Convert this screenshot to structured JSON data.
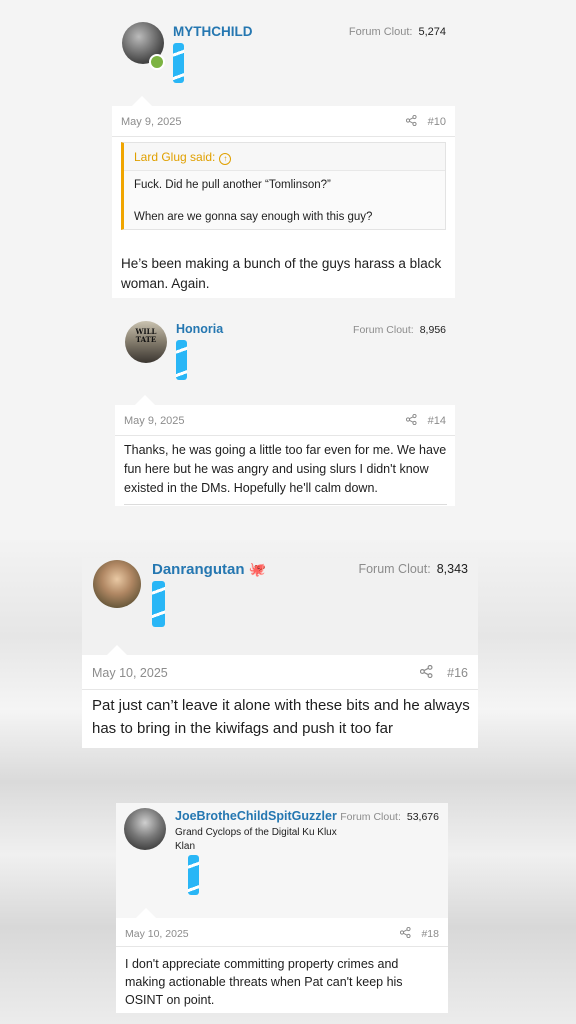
{
  "posts": [
    {
      "username": "MYTHCHILD",
      "forum_clout_label": "Forum Clout:",
      "forum_clout_value": "5,274",
      "date": "May 9, 2025",
      "post_number": "#10",
      "quote": {
        "author": "Lard Glug said:",
        "lines": [
          "Fuck. Did he pull another “Tomlinson?”",
          "When are we gonna say enough with this guy?"
        ]
      },
      "message": "He’s been making a bunch of the guys harass a black woman. Again."
    },
    {
      "username": "Honoria",
      "avatar_text": "WILL TATE",
      "forum_clout_label": "Forum Clout:",
      "forum_clout_value": "8,956",
      "date": "May 9, 2025",
      "post_number": "#14",
      "message": "Thanks, he was going a little too far even for me. We have fun here but he was angry and using slurs I didn't know existed in the DMs. Hopefully he'll calm down."
    },
    {
      "username": "Danrangutan",
      "forum_clout_label": "Forum Clout:",
      "forum_clout_value": "8,343",
      "date": "May 10, 2025",
      "post_number": "#16",
      "message": "Pat just can’t leave it alone with these bits and he always has to bring in the kiwifags and push it too far"
    },
    {
      "username": "JoeBrotheChildSpitGuzzler",
      "user_title": "Grand Cyclops of the Digital Ku Klux Klan",
      "forum_clout_label": "Forum Clout:",
      "forum_clout_value": "53,676",
      "date": "May 10, 2025",
      "post_number": "#18",
      "message": "I don't appreciate committing property crimes and making actionable threats when Pat can't keep his OSINT on point."
    }
  ],
  "icons": [
    "share-icon",
    "online-status-icon",
    "quote-jump-icon",
    "octopus-emoji-icon"
  ],
  "colors": {
    "username": "#2577b1",
    "ribbon": "#29b6f6",
    "quote_accent": "#f0a500",
    "online": "#7cb342"
  }
}
